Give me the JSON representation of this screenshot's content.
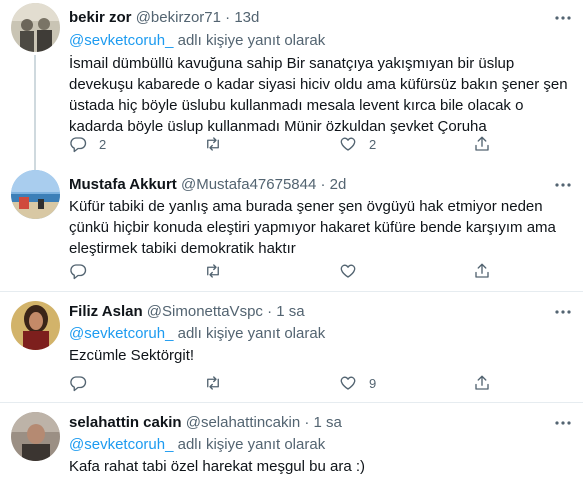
{
  "tweets": [
    {
      "name": "bekir zor",
      "handle": "@bekirzor71",
      "time": "13d",
      "reply_prefix": "",
      "reply_mention": "@sevketcoruh_",
      "reply_suffix": " adlı kişiye yanıt olarak",
      "text_lines": [
        "İsmail dümbüllü kavuğuna sahip Bir sanatçıya yakışmıyan bir üslup",
        "devekuşu kabarede o kadar siyasi hiciv oldu ama küfürsüz bakın şener şen",
        "üstada hiç böyle üslubu kullanmadı mesala levent kırca bile olacak o",
        "kadarda böyle üslup kullanmadı Münir özkuldan şevket Çoruha"
      ],
      "reply_count": "2",
      "retweet_count": "",
      "like_count": "2"
    },
    {
      "name": "Mustafa Akkurt",
      "handle": "@Mustafa47675844",
      "time": "2d",
      "text_lines": [
        "Küfür tabiki de yanlış ama burada şener şen övgüyü hak etmiyor neden",
        "çünkü hiçbir konuda eleştiri yapmıyor hakaret küfüre bende karşıyım ama",
        "eleştirmek tabiki demokratik haktır"
      ],
      "reply_count": "",
      "retweet_count": "",
      "like_count": ""
    },
    {
      "name": "Filiz Aslan",
      "handle": "@SimonettaVspc",
      "time": "1 sa",
      "reply_mention": "@sevketcoruh_",
      "reply_suffix": " adlı kişiye yanıt olarak",
      "text_lines": [
        "Ezcümle Sektörgit!"
      ],
      "reply_count": "",
      "retweet_count": "",
      "like_count": "9"
    },
    {
      "name": "selahattin cakin",
      "handle": "@selahattincakin",
      "time": "1 sa",
      "reply_mention": "@sevketcoruh_",
      "reply_suffix": " adlı kişiye yanıt olarak",
      "text_lines": [
        "Kafa rahat tabi özel harekat meşgul bu ara :)"
      ]
    }
  ],
  "dot": "·",
  "colors": {
    "accent": "#1d9bf0",
    "secondary": "#536471",
    "divider": "#e6ecf0"
  },
  "icons": [
    "more-icon",
    "reply-icon",
    "retweet-icon",
    "like-icon",
    "share-icon"
  ]
}
